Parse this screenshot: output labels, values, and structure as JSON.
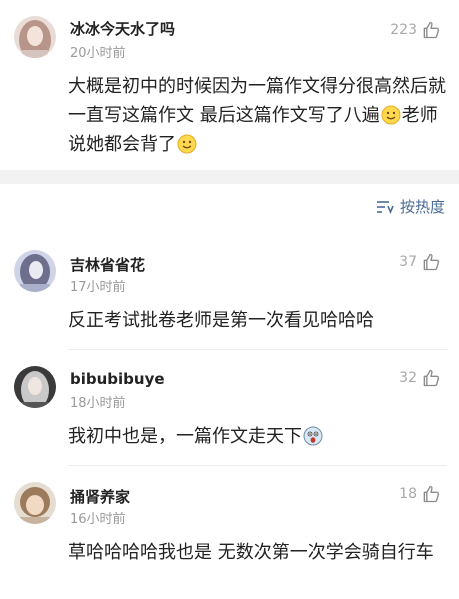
{
  "comments_top": {
    "username": "冰冰今天水了吗",
    "time": "20小时前",
    "likes": "223",
    "text_1": "大概是初中的时候因为一篇作文得分很高然后就一直写这篇作文 最后这篇作文写了八遍",
    "text_2": "老师说她都会背了"
  },
  "sort": {
    "label": "按热度"
  },
  "comments": [
    {
      "username": "吉林省省花",
      "time": "17小时前",
      "likes": "37",
      "text": "反正考试批卷老师是第一次看见哈哈哈"
    },
    {
      "username": "bibubibuye",
      "time": "18小时前",
      "likes": "32",
      "text": "我初中也是，一篇作文走天下"
    },
    {
      "username": "捅肾养家",
      "time": "16小时前",
      "likes": "18",
      "text": "草哈哈哈哈我也是 无数次第一次学会骑自行车"
    }
  ],
  "colors": {
    "link": "#4a6b98",
    "meta": "#9a9a9a",
    "divider": "#f2f2f2"
  }
}
